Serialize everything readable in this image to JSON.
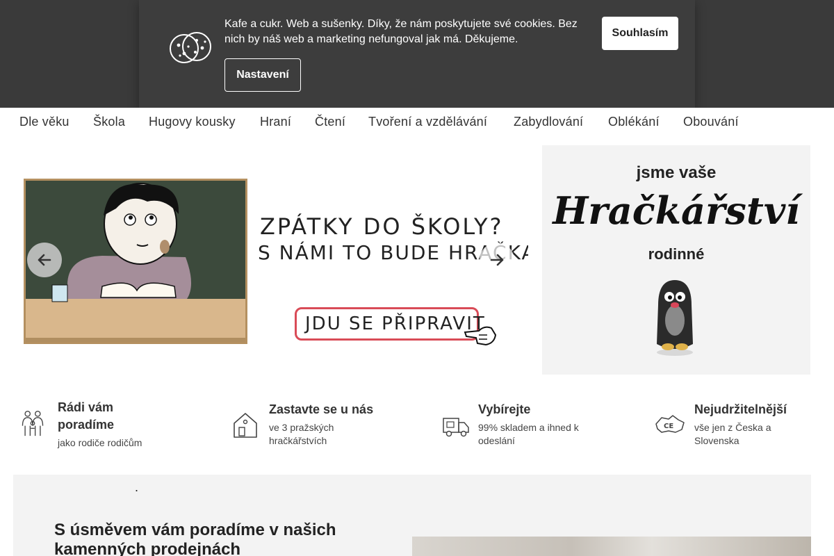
{
  "cookie_bar": {
    "message": "Kafe a cukr. Web a sušenky. Díky, že nám poskytujete své cookies. Bez nich by náš web a marketing nefungoval jak má. Děkujeme.",
    "agree_label": "Souhlasím",
    "settings_label": "Nastavení",
    "icon": "cookie-icon"
  },
  "nav": {
    "items": [
      "Dle věku",
      "Škola",
      "Hugovy kousky",
      "Hraní",
      "Čtení",
      "Tvoření a vzdělávání",
      "Zabydlování",
      "Oblékání",
      "Obouvání"
    ],
    "search_glyph": "",
    "search_icon": "search-icon"
  },
  "hero": {
    "slide": {
      "line1": "ZPÁTKY DO ŠKOLY?",
      "line2": "S NÁMI TO BUDE HRAČKA!",
      "cta": "JDU SE PŘIPRAVIT"
    },
    "side": {
      "line1": "jsme vaše",
      "line2": "Hračkářství",
      "line3": "rodinné"
    },
    "prev_icon": "arrow-left-icon",
    "next_icon": "arrow-right-icon"
  },
  "features": [
    {
      "title": "Rádi vám poradíme",
      "subtitle": "jako rodiče rodičům",
      "icon": "family-icon"
    },
    {
      "title": "Zastavte se u nás",
      "subtitle": "ve 3 pražských hračkářstvích",
      "icon": "house-icon"
    },
    {
      "title": "Vybírejte",
      "subtitle": "99% skladem a ihned k odeslání",
      "icon": "delivery-truck-icon"
    },
    {
      "title": "Nejudržitelnější",
      "subtitle": "vše jen z Česka a Slovenska",
      "icon": "czech-map-icon"
    }
  ],
  "bottom": {
    "dot": ".",
    "title": "S úsměvem vám poradíme v našich kamenných prodejnách"
  },
  "colors": {
    "header_bg": "#3a3a3a",
    "cookie_bg": "#3d3d3d",
    "accent_red": "#d94b57",
    "section_bg": "#f3f3f3"
  }
}
